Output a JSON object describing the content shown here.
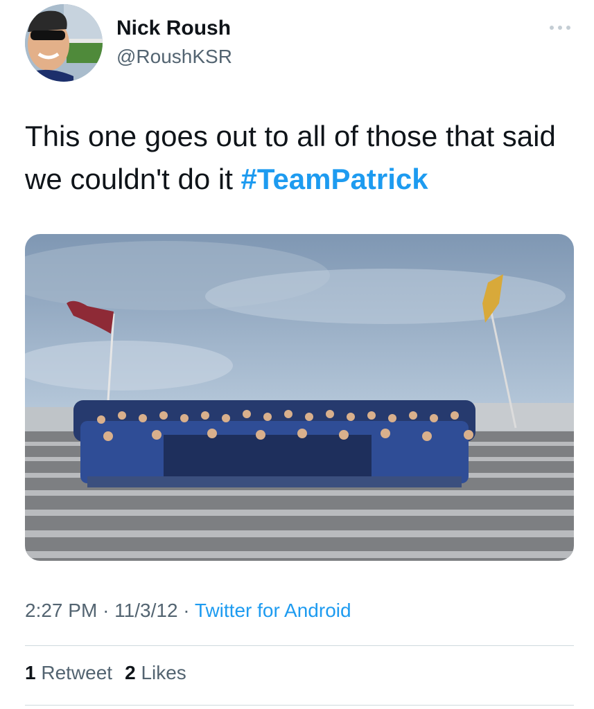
{
  "author": {
    "name": "Nick Roush",
    "handle": "@RoushKSR"
  },
  "tweet": {
    "text_before": "This one goes out to all of those that said we couldn't do it ",
    "hashtag": "#TeamPatrick"
  },
  "meta": {
    "time": "2:27 PM",
    "date": "11/3/12",
    "separator": "·",
    "source": "Twitter for Android"
  },
  "stats": {
    "retweet_count": "1",
    "retweet_label": "Retweet",
    "like_count": "2",
    "like_label": "Likes"
  },
  "icons": {
    "more": "more-horizontal-icon"
  },
  "colors": {
    "link": "#1d9bf0",
    "text": "#0f1419",
    "secondary": "#536471",
    "divider": "#cfd9de"
  }
}
